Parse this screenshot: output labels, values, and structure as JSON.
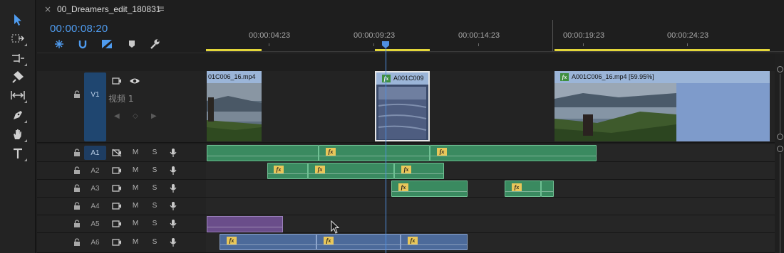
{
  "sequence_tab": {
    "close_glyph": "×",
    "title": "00_Dreamers_edit_180831",
    "menu_glyph": "≡"
  },
  "timecode": "00:00:08:20",
  "timeline_controls": [
    "nest-icon",
    "snap-icon",
    "linked-selection-icon",
    "add-marker-icon",
    "settings-wrench-icon"
  ],
  "ruler": {
    "labels": [
      "00:00:04:23",
      "00:00:09:23",
      "00:00:14:23",
      "00:00:19:23",
      "00:00:24:23"
    ]
  },
  "tools": [
    "selection-tool-icon",
    "track-select-tool-icon",
    "ripple-edit-tool-icon",
    "razor-tool-icon",
    "slip-tool-icon",
    "pen-tool-icon",
    "hand-tool-icon",
    "type-tool-icon"
  ],
  "video_track": {
    "id": "V1",
    "name": "视频 1",
    "clips": [
      {
        "label": "01C006_16.mp4",
        "fx": false
      },
      {
        "label": "A001C009",
        "fx": true
      },
      {
        "label": "A001C006_16.mp4 [59.95%]",
        "fx": true
      }
    ]
  },
  "audio_tracks": [
    {
      "id": "A1",
      "mute": "M",
      "solo": "S",
      "active": true
    },
    {
      "id": "A2",
      "mute": "M",
      "solo": "S",
      "active": false
    },
    {
      "id": "A3",
      "mute": "M",
      "solo": "S",
      "active": false
    },
    {
      "id": "A4",
      "mute": "M",
      "solo": "S",
      "active": false
    },
    {
      "id": "A5",
      "mute": "M",
      "solo": "S",
      "active": false
    },
    {
      "id": "A6",
      "mute": "M",
      "solo": "S",
      "active": false
    }
  ],
  "fx_badge": "fx",
  "colors": {
    "accent": "#4f9cf0",
    "audio_clip": "#3a8a60",
    "audio_clip_blue": "#4c6a9a",
    "audio_clip_purple": "#6a4d8a",
    "work_area": "#e3d63a",
    "video_header": "#9bb5d8"
  }
}
